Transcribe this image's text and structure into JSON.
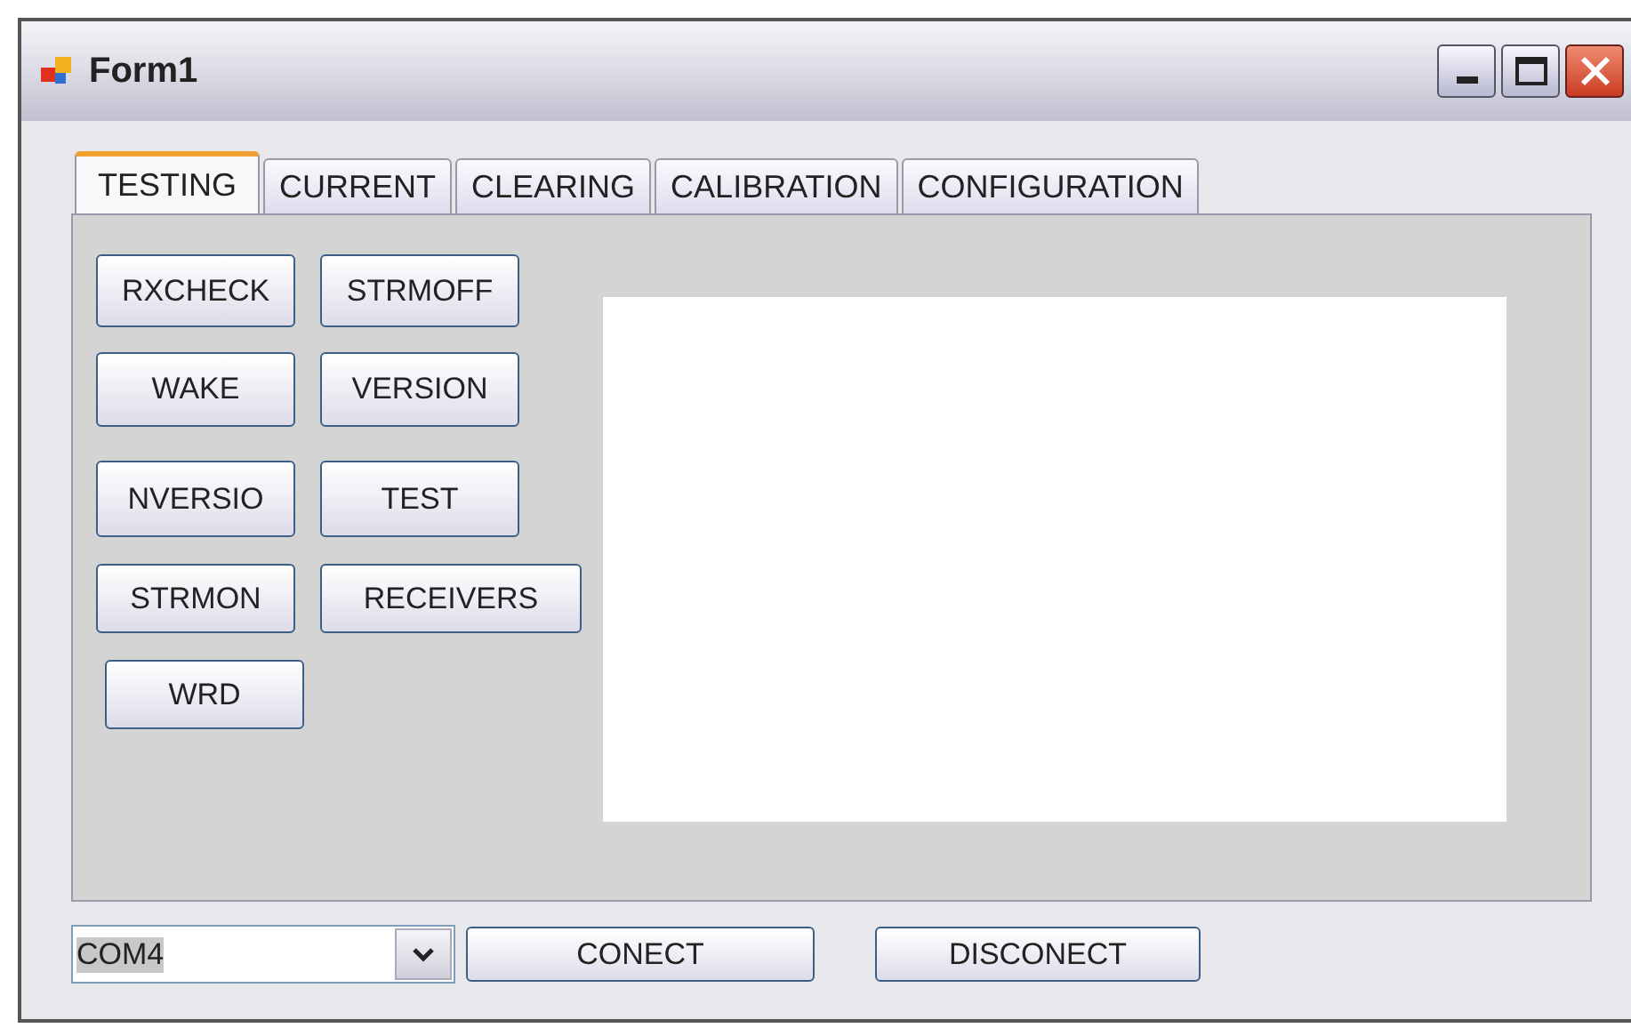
{
  "window": {
    "title": "Form1"
  },
  "tabs": [
    {
      "label": "TESTING",
      "selected": true
    },
    {
      "label": "CURRENT",
      "selected": false
    },
    {
      "label": "CLEARING",
      "selected": false
    },
    {
      "label": "CALIBRATION",
      "selected": false
    },
    {
      "label": "CONFIGURATION",
      "selected": false
    }
  ],
  "button_rows": [
    [
      "RXCHECK",
      "STRMOFF"
    ],
    [
      "WAKE",
      "VERSION"
    ],
    [
      "NVERSIO",
      "TEST"
    ],
    [
      "STRMON",
      "RECEIVERS"
    ],
    [
      "WRD"
    ]
  ],
  "port_combo": {
    "value": "COM4"
  },
  "buttons": [
    "CONECT",
    "DISCONECT"
  ]
}
